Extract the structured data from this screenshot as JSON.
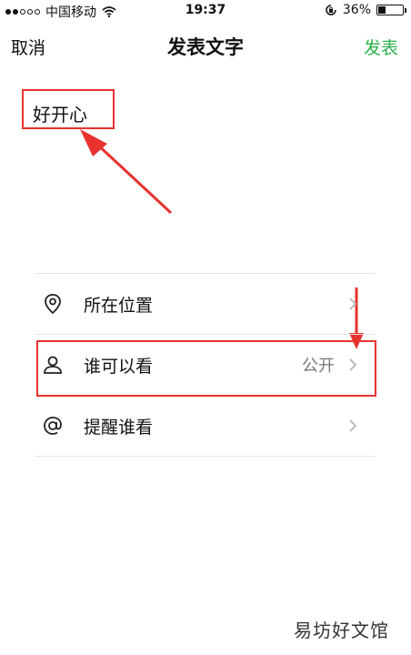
{
  "status": {
    "carrier": "中国移动",
    "time": "19:37",
    "battery": "36%",
    "battery_level": 0.36
  },
  "nav": {
    "cancel": "取消",
    "title": "发表文字",
    "post": "发表"
  },
  "post": {
    "text": "好开心"
  },
  "menu": [
    {
      "label": "所在位置",
      "icon": "location-pin-icon",
      "value": ""
    },
    {
      "label": "谁可以看",
      "icon": "person-icon",
      "value": "公开"
    },
    {
      "label": "提醒谁看",
      "icon": "at-sign-icon",
      "value": ""
    }
  ],
  "watermark": "易坊好文馆",
  "colors": {
    "accent_green": "#2bb24c",
    "annotation_red": "#e8322e"
  }
}
